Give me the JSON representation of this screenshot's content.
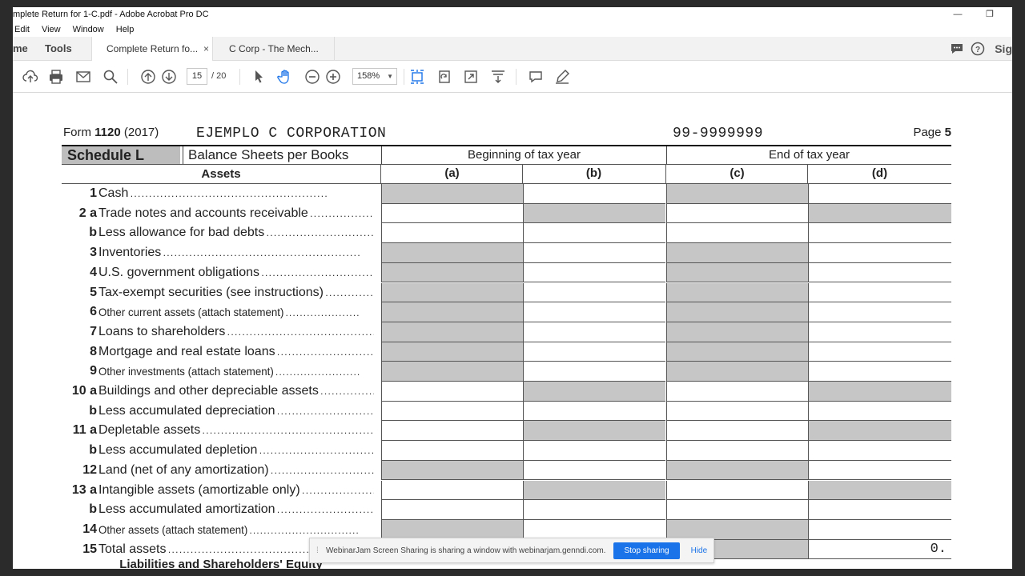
{
  "window": {
    "title": "mplete Return for 1-C.pdf - Adobe Acrobat Pro DC",
    "minimize": "—",
    "maximize": "❐"
  },
  "menu": [
    "Edit",
    "View",
    "Window",
    "Help"
  ],
  "tabs": {
    "home": "me",
    "tools": "Tools",
    "doc1": "Complete Return fo...",
    "doc1_close": "×",
    "doc2": "C Corp - The Mech...",
    "sign": "Sig"
  },
  "toolbar": {
    "page_current": "15",
    "page_total": "/ 20",
    "zoom": "158%"
  },
  "form": {
    "form_label": "Form",
    "form_number": "1120",
    "form_year": "(2017)",
    "corporation": "EJEMPLO C CORPORATION",
    "ein": "99-9999999",
    "page_label": "Page",
    "page_number": "5",
    "schedule": "Schedule L",
    "schedule_title": "Balance Sheets per Books",
    "beginning": "Beginning of tax year",
    "end": "End of tax year",
    "assets_header": "Assets",
    "columns": [
      "(a)",
      "(b)",
      "(c)",
      "(d)"
    ],
    "liabilities_header": "Liabilities and Shareholders' Equity",
    "rows": [
      {
        "num": "1",
        "label": "Cash",
        "small": false,
        "shade": [
          true,
          false,
          true,
          false
        ],
        "values": [
          "",
          "",
          "",
          ""
        ]
      },
      {
        "num": "2 a",
        "label": "Trade notes and accounts receivable",
        "small": false,
        "shade": [
          false,
          true,
          false,
          true
        ],
        "values": [
          "",
          "",
          "",
          ""
        ]
      },
      {
        "num": "b",
        "label": "Less allowance for bad debts",
        "small": false,
        "shade": [
          false,
          false,
          false,
          false
        ],
        "values": [
          "",
          "",
          "",
          ""
        ]
      },
      {
        "num": "3",
        "label": "Inventories",
        "small": false,
        "shade": [
          true,
          false,
          true,
          false
        ],
        "values": [
          "",
          "",
          "",
          ""
        ]
      },
      {
        "num": "4",
        "label": "U.S. government obligations",
        "small": false,
        "shade": [
          true,
          false,
          true,
          false
        ],
        "values": [
          "",
          "",
          "",
          ""
        ]
      },
      {
        "num": "5",
        "label": "Tax-exempt securities (see instructions)",
        "small": false,
        "shade": [
          true,
          false,
          true,
          false
        ],
        "values": [
          "",
          "",
          "",
          ""
        ]
      },
      {
        "num": "6",
        "label": "Other current assets (attach statement)",
        "small": true,
        "shade": [
          true,
          false,
          true,
          false
        ],
        "values": [
          "",
          "",
          "",
          ""
        ]
      },
      {
        "num": "7",
        "label": "Loans to shareholders",
        "small": false,
        "shade": [
          true,
          false,
          true,
          false
        ],
        "values": [
          "",
          "",
          "",
          ""
        ]
      },
      {
        "num": "8",
        "label": "Mortgage and real estate loans",
        "small": false,
        "shade": [
          true,
          false,
          true,
          false
        ],
        "values": [
          "",
          "",
          "",
          ""
        ]
      },
      {
        "num": "9",
        "label": "Other investments (attach statement)",
        "small": true,
        "shade": [
          true,
          false,
          true,
          false
        ],
        "values": [
          "",
          "",
          "",
          ""
        ]
      },
      {
        "num": "10 a",
        "label": "Buildings and other depreciable assets",
        "small": false,
        "shade": [
          false,
          true,
          false,
          true
        ],
        "values": [
          "",
          "",
          "",
          ""
        ]
      },
      {
        "num": "b",
        "label": "Less accumulated depreciation",
        "small": false,
        "shade": [
          false,
          false,
          false,
          false
        ],
        "values": [
          "",
          "",
          "",
          ""
        ]
      },
      {
        "num": "11 a",
        "label": "Depletable assets",
        "small": false,
        "shade": [
          false,
          true,
          false,
          true
        ],
        "values": [
          "",
          "",
          "",
          ""
        ]
      },
      {
        "num": "b",
        "label": "Less accumulated depletion",
        "small": false,
        "shade": [
          false,
          false,
          false,
          false
        ],
        "values": [
          "",
          "",
          "",
          ""
        ]
      },
      {
        "num": "12",
        "label": "Land (net of any amortization)",
        "small": false,
        "shade": [
          true,
          false,
          true,
          false
        ],
        "values": [
          "",
          "",
          "",
          ""
        ]
      },
      {
        "num": "13 a",
        "label": "Intangible assets (amortizable only)",
        "small": false,
        "shade": [
          false,
          true,
          false,
          true
        ],
        "values": [
          "",
          "",
          "",
          ""
        ]
      },
      {
        "num": "b",
        "label": "Less accumulated amortization",
        "small": false,
        "shade": [
          false,
          false,
          false,
          false
        ],
        "values": [
          "",
          "",
          "",
          ""
        ]
      },
      {
        "num": "14",
        "label": "Other assets (attach statement)",
        "small": true,
        "shade": [
          true,
          false,
          true,
          false
        ],
        "values": [
          "",
          "",
          "",
          ""
        ]
      },
      {
        "num": "15",
        "label": "Total assets",
        "small": false,
        "shade": [
          true,
          false,
          true,
          false
        ],
        "values": [
          "",
          "",
          "",
          "0."
        ]
      }
    ]
  },
  "share": {
    "message": "WebinarJam Screen Sharing is sharing a window with webinarjam.genndi.com.",
    "stop": "Stop sharing",
    "hide": "Hide"
  },
  "colors": {
    "shade": "#c6c6c6",
    "schedule_label_bg": "#bdbdbd",
    "accent": "#1a73e8"
  }
}
